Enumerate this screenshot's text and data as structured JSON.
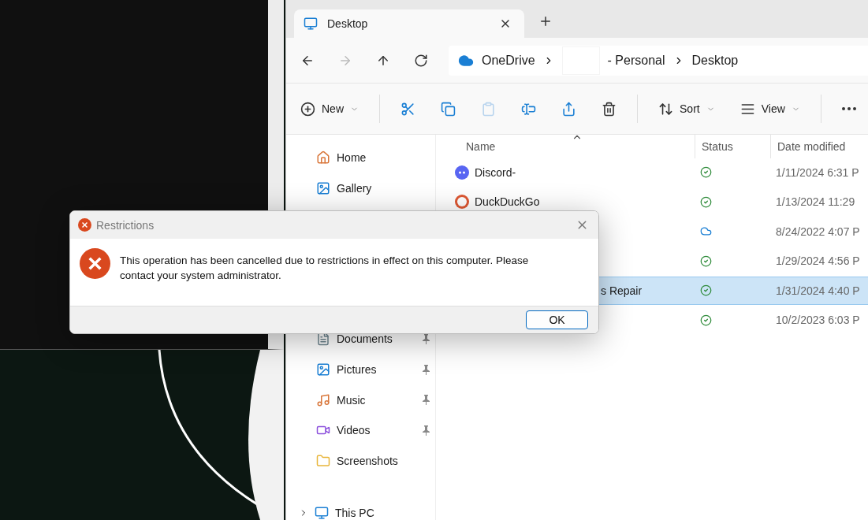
{
  "explorer": {
    "tabs": [
      {
        "label": "Desktop",
        "selected": true
      }
    ],
    "breadcrumb": [
      {
        "label": "OneDrive",
        "kind": "cloud"
      },
      {
        "label": "- Personal",
        "kind": "redacted"
      },
      {
        "label": "Desktop",
        "kind": "plain"
      }
    ],
    "nav_buttons": [
      {
        "kind": "back",
        "disabled": false
      },
      {
        "kind": "forward",
        "disabled": true
      },
      {
        "kind": "up",
        "disabled": false
      },
      {
        "kind": "refresh",
        "disabled": false
      }
    ],
    "toolbar": [
      {
        "kind": "new",
        "label": "New",
        "disabled": false
      },
      {
        "kind": "cut",
        "disabled": false
      },
      {
        "kind": "copy",
        "disabled": false
      },
      {
        "kind": "paste",
        "disabled": true
      },
      {
        "kind": "rename",
        "disabled": false
      },
      {
        "kind": "share",
        "disabled": false
      },
      {
        "kind": "delete",
        "disabled": false
      },
      {
        "kind": "sort",
        "label": "Sort",
        "disabled": false
      },
      {
        "kind": "view",
        "label": "View",
        "disabled": false
      },
      {
        "kind": "more",
        "disabled": false
      }
    ],
    "sidebar": {
      "top": [
        {
          "label": "Home",
          "pinned": false
        },
        {
          "label": "Gallery",
          "pinned": false
        }
      ],
      "quick": [
        {
          "label": "Documents",
          "pinned": true
        },
        {
          "label": "Pictures",
          "pinned": true
        },
        {
          "label": "Music",
          "pinned": true
        },
        {
          "label": "Videos",
          "pinned": true
        },
        {
          "label": "Screenshots",
          "pinned": false
        }
      ],
      "bottom": [
        {
          "label": "This PC",
          "expanded": false
        }
      ]
    },
    "table": {
      "columns": [
        "Name",
        "Status",
        "Date modified"
      ],
      "rows": [
        {
          "name": "Discord-",
          "synced": true,
          "date": "1/11/2024 6:31 P",
          "selected": false
        },
        {
          "name": "DuckDuckGo",
          "synced": true,
          "date": "1/13/2024 11:29",
          "selected": false
        },
        {
          "synced": false,
          "date": "8/24/2022 4:07 P",
          "selected": false
        },
        {
          "synced": true,
          "date": "1/29/2024 4:56 P",
          "selected": false
        },
        {
          "name": "s Repair",
          "synced": true,
          "date": "1/31/2024 4:40 P",
          "selected": true
        },
        {
          "synced": true,
          "date": "10/2/2023 6:03 P",
          "selected": false
        }
      ]
    }
  },
  "dialog": {
    "title": "Restrictions",
    "message": "This operation has been cancelled due to restrictions in effect on this computer. Please contact your system administrator.",
    "buttons": [
      "OK"
    ]
  }
}
